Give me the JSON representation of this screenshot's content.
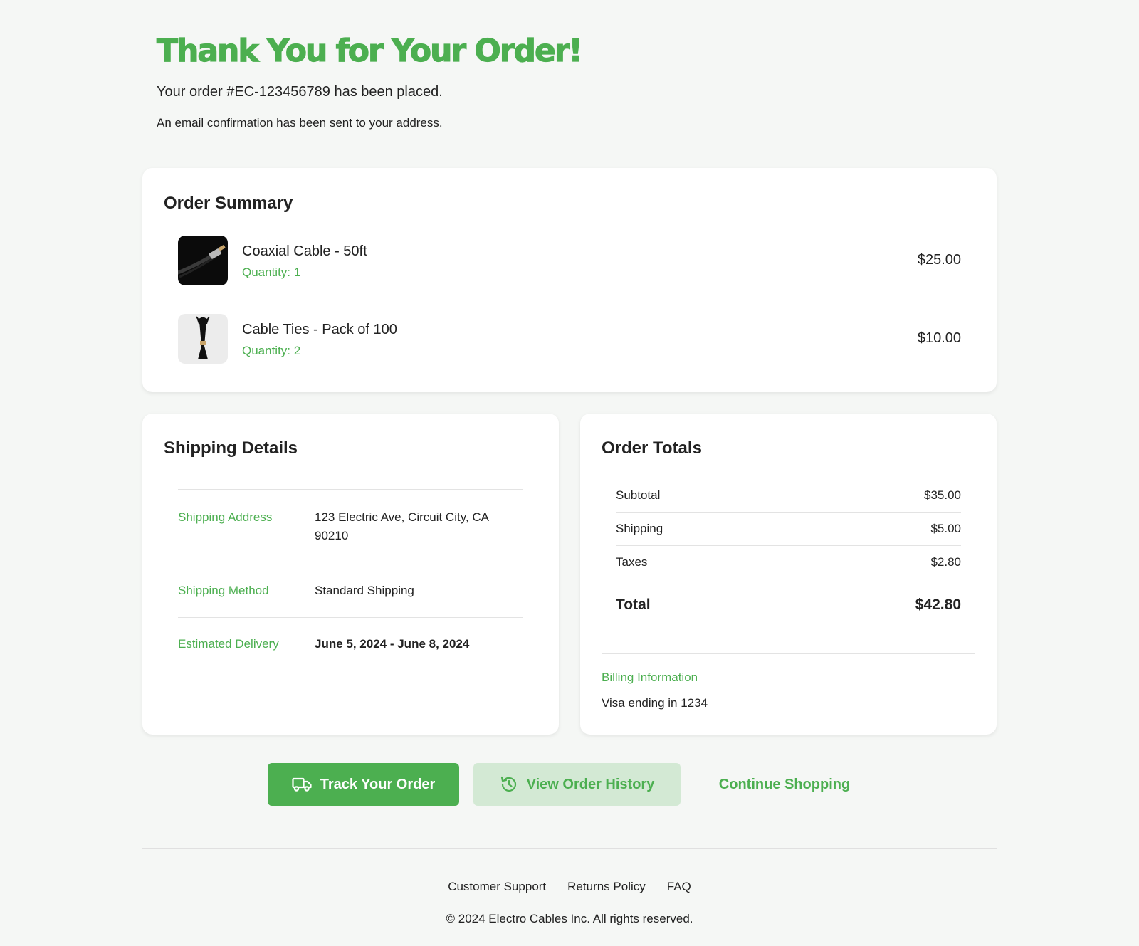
{
  "header": {
    "title": "Thank You for Your Order!",
    "order_line": "Your order #EC-123456789 has been placed.",
    "email_line": "An email confirmation has been sent to your address."
  },
  "summary": {
    "title": "Order Summary",
    "items": [
      {
        "name": "Coaxial Cable - 50ft",
        "quantity": "Quantity: 1",
        "price": "$25.00",
        "image": "coaxial-cable-image"
      },
      {
        "name": "Cable Ties - Pack of 100",
        "quantity": "Quantity: 2",
        "price": "$10.00",
        "image": "cable-ties-image"
      }
    ]
  },
  "shipping": {
    "title": "Shipping Details",
    "rows": [
      {
        "label": "Shipping Address",
        "value": "123 Electric Ave, Circuit City, CA 90210"
      },
      {
        "label": "Shipping Method",
        "value": "Standard Shipping"
      },
      {
        "label": "Estimated Delivery",
        "value": "June 5, 2024 - June 8, 2024"
      }
    ]
  },
  "totals": {
    "title": "Order Totals",
    "rows": [
      {
        "label": "Subtotal",
        "value": "$35.00"
      },
      {
        "label": "Shipping",
        "value": "$5.00"
      },
      {
        "label": "Taxes",
        "value": "$2.80"
      }
    ],
    "total_label": "Total",
    "total_value": "$42.80",
    "billing_label": "Billing Information",
    "billing_value": "Visa ending in 1234"
  },
  "actions": {
    "track": "Track Your Order",
    "history": "View Order History",
    "continue": "Continue Shopping"
  },
  "footer": {
    "links": [
      "Customer Support",
      "Returns Policy",
      "FAQ"
    ],
    "copyright": "© 2024 Electro Cables Inc. All rights reserved."
  },
  "colors": {
    "accent": "#4caf50",
    "accent_light": "#d3e9d4",
    "background": "#f5f7f5"
  },
  "icons": {
    "track": "truck-icon",
    "history": "history-icon"
  }
}
